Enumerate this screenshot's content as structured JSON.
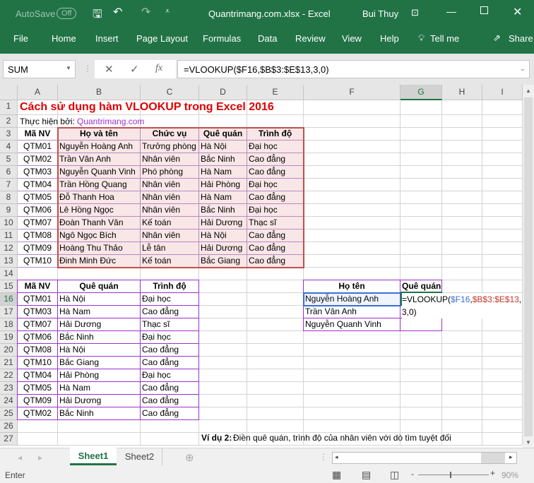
{
  "titlebar": {
    "autosave": "AutoSave",
    "autosave_state": "Off",
    "filename": "Quantrimang.com.xlsx  -  Excel",
    "user": "Bui Thuy"
  },
  "ribbon": {
    "tabs": [
      "File",
      "Home",
      "Insert",
      "Page Layout",
      "Formulas",
      "Data",
      "Review",
      "View",
      "Help"
    ],
    "tell_me": "Tell me",
    "share": "Share"
  },
  "formula_bar": {
    "name_box": "SUM",
    "formula": "=VLOOKUP($F16,$B$3:$E$13,3,0)",
    "fx": "fx"
  },
  "columns": [
    "A",
    "B",
    "C",
    "D",
    "E",
    "F",
    "G",
    "H",
    "I"
  ],
  "rows": {
    "1": {
      "A": "Cách sử dụng hàm VLOOKUP trong Excel 2016"
    },
    "2": {
      "A": "Thực hiện bởi: ",
      "A2": "Quantrimang.com"
    },
    "3": {
      "A": "Mã NV",
      "B": "Họ và tên",
      "C": "Chức vụ",
      "D": "Quê quán",
      "E": "Trình độ"
    },
    "4": {
      "A": "QTM01",
      "B": "Nguyễn Hoàng Anh",
      "C": "Trưởng phòng",
      "D": "Hà Nội",
      "E": "Đại học"
    },
    "5": {
      "A": "QTM02",
      "B": "Trần Vân Anh",
      "C": "Nhân viên",
      "D": "Bắc Ninh",
      "E": "Cao đẳng"
    },
    "6": {
      "A": "QTM03",
      "B": "Nguyễn Quanh Vinh",
      "C": "Phó phòng",
      "D": "Hà Nam",
      "E": "Cao đẳng"
    },
    "7": {
      "A": "QTM04",
      "B": "Trần Hồng Quang",
      "C": "Nhân viên",
      "D": "Hải Phòng",
      "E": "Đại học"
    },
    "8": {
      "A": "QTM05",
      "B": "Đỗ Thanh Hoa",
      "C": "Nhân viên",
      "D": "Hà Nam",
      "E": "Cao đẳng"
    },
    "9": {
      "A": "QTM06",
      "B": "Lê Hồng Ngọc",
      "C": "Nhân viên",
      "D": "Bắc Ninh",
      "E": "Đại học"
    },
    "10": {
      "A": "QTM07",
      "B": "Đoàn Thanh Vân",
      "C": "Kế toán",
      "D": "Hải Dương",
      "E": "Thạc sĩ"
    },
    "11": {
      "A": "QTM08",
      "B": "Ngô Ngọc Bích",
      "C": "Nhân viên",
      "D": "Hà Nội",
      "E": "Cao đẳng"
    },
    "12": {
      "A": "QTM09",
      "B": "Hoàng Thu Thảo",
      "C": "Lễ tân",
      "D": "Hải Dương",
      "E": "Cao đẳng"
    },
    "13": {
      "A": "QTM10",
      "B": "Đinh Minh Đức",
      "C": "Kế toán",
      "D": "Bắc Giang",
      "E": "Cao đẳng"
    },
    "15": {
      "A": "Mã NV",
      "B": "Quê quán",
      "C": "Trình độ",
      "F": "Họ tên",
      "G": "Quê quán"
    },
    "16": {
      "A": "QTM01",
      "B": "Hà Nội",
      "C": "Đại học",
      "F": "Nguyễn Hoàng Anh"
    },
    "17": {
      "A": "QTM03",
      "B": "Hà Nam",
      "C": "Cao đẳng",
      "F": "Trần Vân Anh"
    },
    "18": {
      "A": "QTM07",
      "B": "Hải Dương",
      "C": "Thạc sĩ",
      "F": "Nguyễn Quanh Vinh"
    },
    "19": {
      "A": "QTM06",
      "B": "Bắc Ninh",
      "C": "Đại học"
    },
    "20": {
      "A": "QTM08",
      "B": "Hà Nội",
      "C": "Cao đẳng"
    },
    "21": {
      "A": "QTM10",
      "B": "Bắc Giang",
      "C": "Cao đẳng"
    },
    "22": {
      "A": "QTM04",
      "B": "Hải Phòng",
      "C": "Đại học"
    },
    "23": {
      "A": "QTM05",
      "B": "Hà Nam",
      "C": "Cao đẳng"
    },
    "24": {
      "A": "QTM09",
      "B": "Hải Dương",
      "C": "Cao đẳng"
    },
    "25": {
      "A": "QTM02",
      "B": "Bắc Ninh",
      "C": "Cao đẳng"
    },
    "27": {
      "D": "Ví dụ 2:",
      "D2": " Điền quê quán, trình độ của nhân viên với dò tìm tuyệt đối"
    }
  },
  "edit": {
    "p1": "=VLOOKUP(",
    "p2": "$F16",
    "p3": ",",
    "p4": "$B$3:$E$13",
    "p5": ",",
    "p6": "3,0)"
  },
  "sheets": [
    "Sheet1",
    "Sheet2"
  ],
  "status": {
    "mode": "Enter",
    "zoom": "90%"
  },
  "colors": {
    "excel_green": "#217346",
    "title_red": "#e00000",
    "ref_blue": "#3a6fd8",
    "ref_red": "#c0392b",
    "purple": "#9932cc"
  }
}
